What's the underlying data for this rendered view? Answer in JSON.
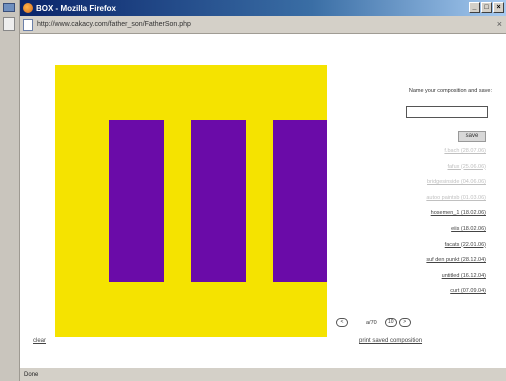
{
  "window": {
    "title": "BOX - Mozilla Firefox",
    "url": "http://www.cakacy.com/father_son/FatherSon.php",
    "status": "Done"
  },
  "artwork": {
    "background_color": "#f5e300",
    "bar_color": "#6a0ba8",
    "bars": 3
  },
  "panel": {
    "name_label": "Name your composition and save:",
    "name_value": "",
    "save_label": "save",
    "compositions": [
      {
        "label": "f.bach (28.07.06)",
        "style": "faded"
      },
      {
        "label": "fafux (25.06.06)",
        "style": "faded"
      },
      {
        "label": "bridgesinside (04.06.06)",
        "style": "faded"
      },
      {
        "label": "autoo paintsb (01.03.06)",
        "style": "faded"
      },
      {
        "label": "hosemen_1 (18.02.06)",
        "style": "active"
      },
      {
        "label": "eiis (18.02.06)",
        "style": "active"
      },
      {
        "label": "facats (22.01.06)",
        "style": "active"
      },
      {
        "label": "suf den punkt (28.12.04)",
        "style": "active"
      },
      {
        "label": "untitled (16.12.04)",
        "style": "active"
      },
      {
        "label": "curt (07.09.04)",
        "style": "active"
      }
    ]
  },
  "pager": {
    "prev_label": "<",
    "info": "a/70",
    "page_label": "10",
    "next_label": ">"
  },
  "links": {
    "clear": "clear",
    "print": "print saved composition"
  }
}
